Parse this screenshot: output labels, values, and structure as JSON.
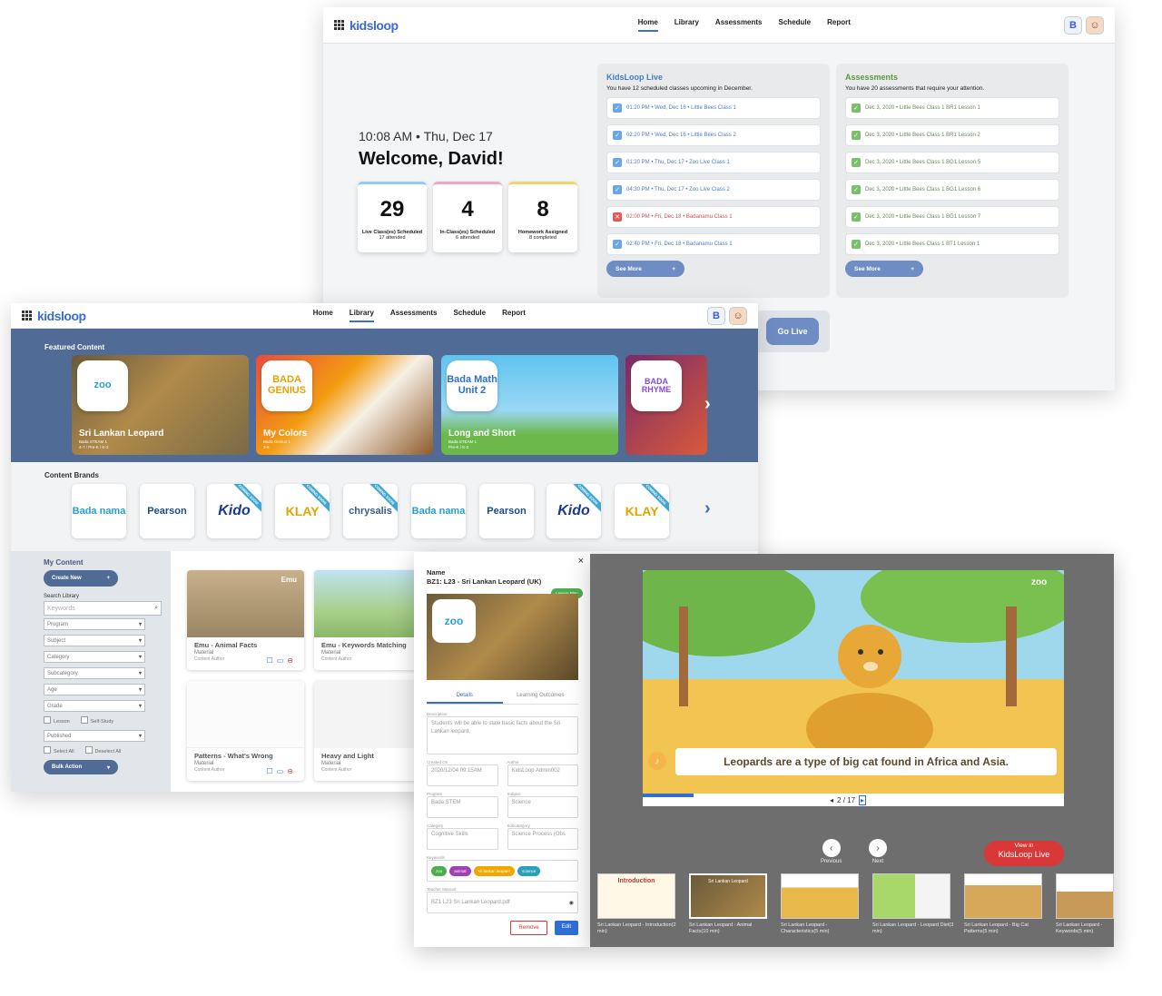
{
  "brand": "kidsloop",
  "nav": [
    "Home",
    "Library",
    "Assessments",
    "Schedule",
    "Report"
  ],
  "dashboard": {
    "clock": "10:08 AM • Thu, Dec 17",
    "welcome": "Welcome, David!",
    "stats": [
      {
        "num": "29",
        "label": "Live Class(es) Scheduled",
        "sub": "17 attended"
      },
      {
        "num": "4",
        "label": "In-Class(es) Scheduled",
        "sub": "6 attended"
      },
      {
        "num": "8",
        "label": "Homework Assigned",
        "sub": "8 completed"
      }
    ],
    "live": {
      "title": "KidsLoop Live",
      "desc": "You have 12 scheduled classes upcoming in December.",
      "rows": [
        {
          "text": "01:20 PM • Wed, Dec 16 • Little Bees Class 1",
          "status": "ok"
        },
        {
          "text": "02:20 PM • Wed, Dec 16 • Little Bees Class 2",
          "status": "ok"
        },
        {
          "text": "01:20 PM • Thu, Dec 17 • Zoo Live Class 1",
          "status": "ok"
        },
        {
          "text": "04:30 PM • Thu, Dec 17 • Zoo Live Class 2",
          "status": "ok"
        },
        {
          "text": "02:00 PM • Fri, Dec 18 • Badanamu Class 1",
          "status": "cancel"
        },
        {
          "text": "02:40 PM • Fri, Dec 18 • Badanamu Class 1",
          "status": "ok"
        }
      ],
      "see_more": "See More"
    },
    "assess": {
      "title": "Assessments",
      "desc": "You have 20 assessments that require your attention.",
      "rows": [
        "Dec 3, 2020 • Little Bees Class 1 BR1 Lesson 1",
        "Dec 3, 2020 • Little Bees Class 1 BR1 Lesson 2",
        "Dec 3, 2020 • Little Bees Class 1 BG1 Lesson 5",
        "Dec 3, 2020 • Little Bees Class 1 BG1 Lesson 6",
        "Dec 3, 2020 • Little Bees Class 1 BG1 Lesson 7",
        "Dec 3, 2020 • Little Bees Class 1 BT1 Lesson 1"
      ],
      "see_more": "See More"
    },
    "go_live": "Go Live"
  },
  "library": {
    "featured_title": "Featured Content",
    "featured": [
      {
        "badge": "zoo",
        "title": "Sri Lankan Leopard",
        "sub1": "Bada STEAM 1",
        "sub2": "4-7 / Pre-K / K-2"
      },
      {
        "badge": "BADA GENIUS",
        "title": "My Colors",
        "sub1": "Bada Genius 1",
        "sub2": "3-6"
      },
      {
        "badge": "Bada Math Unit 2",
        "title": "Long and Short",
        "sub1": "Bada STEAM 1",
        "sub2": "Pre-K / K-2"
      },
      {
        "badge": "BADA RHYME",
        "title": "",
        "sub1": "",
        "sub2": ""
      }
    ],
    "brands_title": "Content Brands",
    "brands": [
      "Bada nama",
      "Pearson",
      "Kido",
      "KLAY",
      "chrysalis",
      "Bada nama",
      "Pearson",
      "Kido",
      "KLAY"
    ],
    "coming_soon": "COMING SOON",
    "my_content": "My Content",
    "create_new": "Create New",
    "search_label": "Search Library",
    "keywords_ph": "Keywords",
    "filters": [
      "Program",
      "Subject",
      "Category",
      "Subcategory",
      "Age",
      "Grade"
    ],
    "checks1": [
      "Lesson",
      "Self-Study"
    ],
    "published": "Published",
    "checks2": [
      "Select All",
      "Deselect All"
    ],
    "bulk": "Bulk Action",
    "cards": [
      {
        "title": "Emu - Animal Facts",
        "type": "Material",
        "author": "Content Author",
        "tag": "Emu"
      },
      {
        "title": "Emu - Keywords Matching",
        "type": "Material",
        "author": "Content Author",
        "tag": ""
      },
      {
        "title": "Patterns - What's Wrong",
        "type": "Material",
        "author": "Content Author",
        "tag": ""
      },
      {
        "title": "Heavy and Light",
        "type": "Material",
        "author": "Content Author",
        "tag": ""
      }
    ]
  },
  "details": {
    "name_label": "Name",
    "name": "BZ1: L23 - Sri Lankan Leopard (UK)",
    "plan_tag": "Lesson Plan",
    "tabs": [
      "Details",
      "Learning Outcomes"
    ],
    "desc_label": "Description",
    "desc": "Students will be able to state basic facts about the Sri Lankan leopard.",
    "created_label": "Created On",
    "created": "2020/12/04 09:15AM",
    "author_label": "Author",
    "author": "KidsLoop Admin002",
    "program_label": "Program",
    "program": "Bada STEM",
    "subject_label": "Subject",
    "subject": "Science",
    "category_label": "Category",
    "category": "Cognitive Skills",
    "subcat_label": "Subcategory",
    "subcat": "Science Process (Obs",
    "keywords_label": "Keywords",
    "keywords": [
      "zoo",
      "animal",
      "sri lankan leopard",
      "science"
    ],
    "manual_label": "Teacher Manual",
    "manual": "BZ1 L23 Sri Lankan Leopard.pdf",
    "remove": "Remove",
    "edit": "Edit",
    "close": "×"
  },
  "viewer": {
    "caption": "Leopards are a type of big cat found in Africa and Asia.",
    "page": "2 / 17",
    "progress": 0.12,
    "previous": "Previous",
    "next": "Next",
    "view_in": "View in",
    "view_in2": "KidsLoop Live",
    "thumbs": [
      {
        "cap": "Sri Lankan Leopard - Introduction(2 min)",
        "label": "Introduction"
      },
      {
        "cap": "Sri Lankan Leopard - Animal Facts(10 min)",
        "label": "Sri Lankan Leopard"
      },
      {
        "cap": "Sri Lankan Leopard - Characteristics(5 min)",
        "label": ""
      },
      {
        "cap": "Sri Lankan Leopard - Leopard Diet(3 min)",
        "label": ""
      },
      {
        "cap": "Sri Lankan Leopard - Big Cat Patterns(5 min)",
        "label": ""
      },
      {
        "cap": "Sri Lankan Leopard - Keywords(5 min)",
        "label": ""
      }
    ]
  },
  "colors": {
    "primary": "#4f6b96",
    "accent": "#3b6bd6",
    "live_red": "#d93838"
  }
}
